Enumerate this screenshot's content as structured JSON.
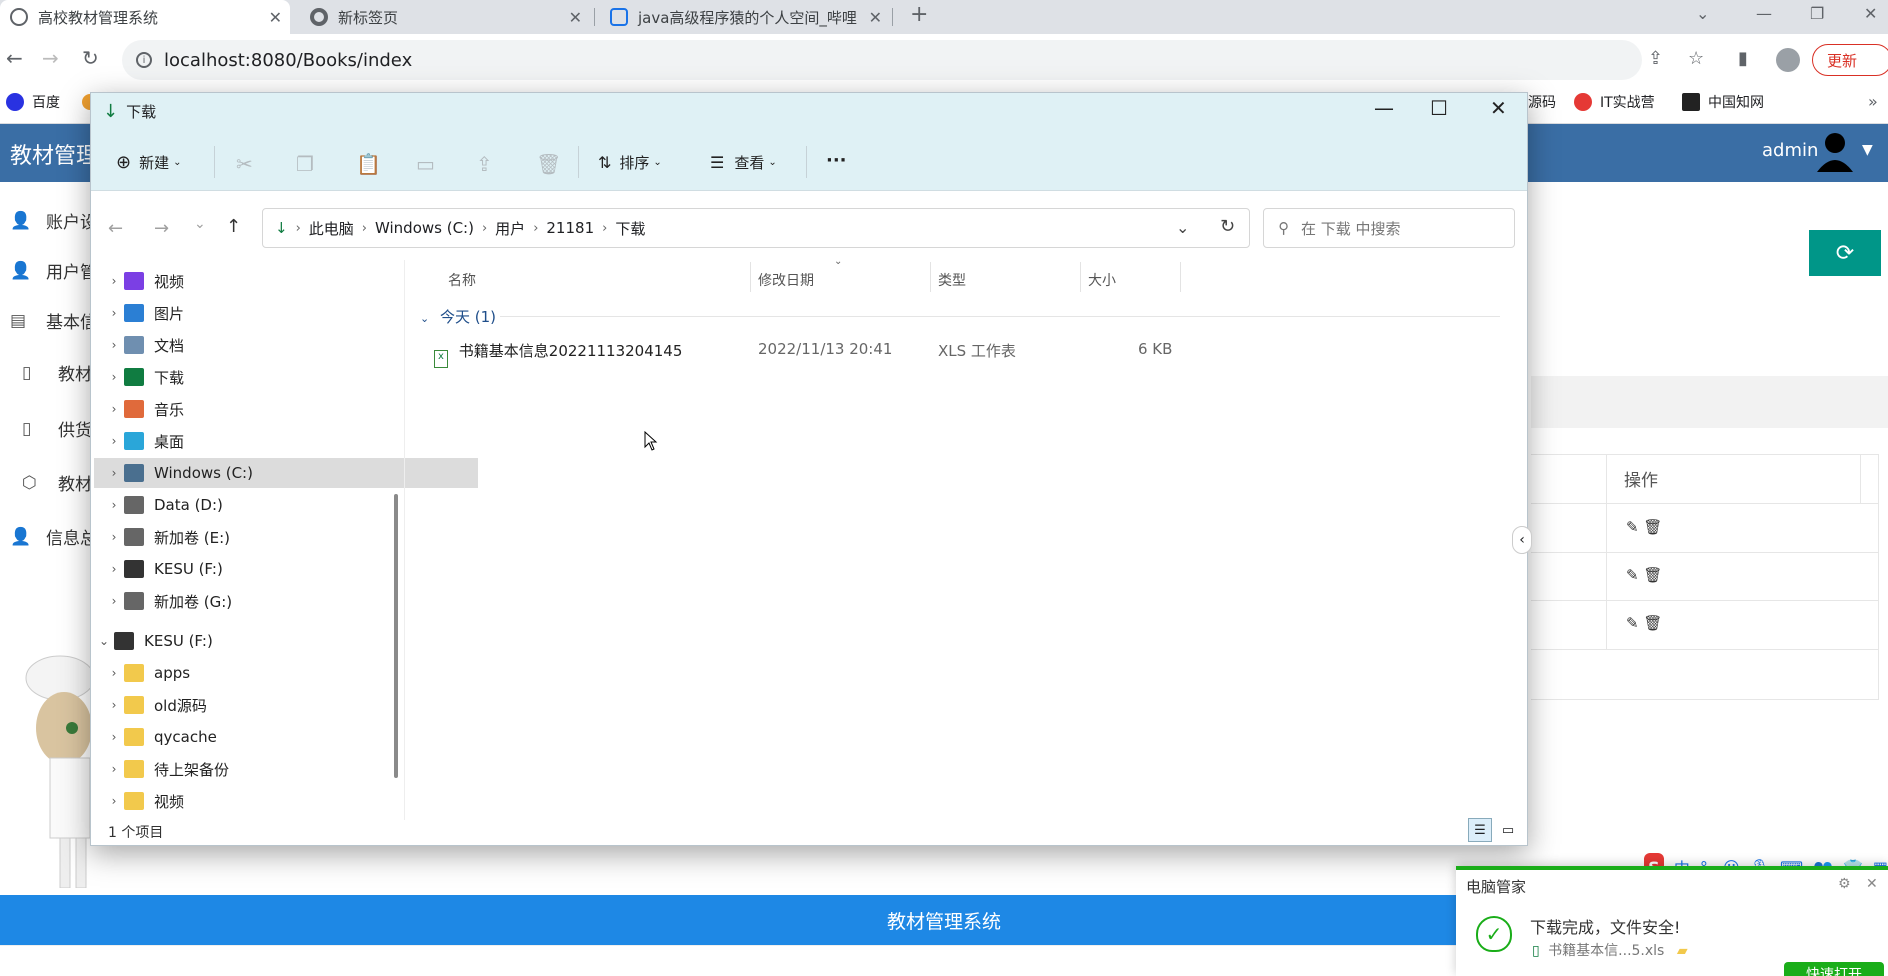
{
  "browser": {
    "tabs": [
      {
        "title": "高校教材管理系统",
        "active": true
      },
      {
        "title": "新标签页",
        "active": false
      },
      {
        "title": "java高级程序猿的个人空间_哔哩",
        "active": false
      }
    ],
    "url": "localhost:8080/Books/index",
    "update_label": "更新",
    "bookmarks": [
      "百度",
      "源码",
      "IT实战营",
      "中国知网"
    ]
  },
  "app": {
    "brand": "教材管理",
    "user": "admin",
    "sidebar": [
      "账户设",
      "用户管",
      "基本信",
      "教材",
      "供货",
      "教材",
      "信息总"
    ],
    "table_ops_header": "操作",
    "footer": "教材管理系统"
  },
  "explorer": {
    "title": "下载",
    "toolbar": {
      "new": "新建",
      "sort": "排序",
      "view": "查看",
      "more": "···"
    },
    "breadcrumb": [
      "此电脑",
      "Windows (C:)",
      "用户",
      "21181",
      "下载"
    ],
    "search_placeholder": "在 下载 中搜索",
    "tree": [
      {
        "label": "视频",
        "color": "#7b3fe4",
        "level": 1
      },
      {
        "label": "图片",
        "color": "#2b7fd4",
        "level": 1
      },
      {
        "label": "文档",
        "color": "#6f8fb0",
        "level": 1
      },
      {
        "label": "下载",
        "color": "#107c41",
        "level": 1
      },
      {
        "label": "音乐",
        "color": "#e06a3b",
        "level": 1
      },
      {
        "label": "桌面",
        "color": "#2aa6d9",
        "level": 1
      },
      {
        "label": "Windows (C:)",
        "color": "#4a6f8f",
        "level": 1,
        "selected": true
      },
      {
        "label": "Data (D:)",
        "color": "#666666",
        "level": 1
      },
      {
        "label": "新加卷 (E:)",
        "color": "#666666",
        "level": 1
      },
      {
        "label": "KESU  (F:)",
        "color": "#333333",
        "level": 1
      },
      {
        "label": "新加卷 (G:)",
        "color": "#666666",
        "level": 1
      },
      {
        "label": "KESU  (F:)",
        "color": "#333333",
        "level": 0,
        "expanded": true
      },
      {
        "label": "apps",
        "color": "#f2c94c",
        "level": 1
      },
      {
        "label": "old源码",
        "color": "#f2c94c",
        "level": 1
      },
      {
        "label": "qycache",
        "color": "#f2c94c",
        "level": 1
      },
      {
        "label": "待上架备份",
        "color": "#f2c94c",
        "level": 1
      },
      {
        "label": "视频",
        "color": "#f2c94c",
        "level": 1
      }
    ],
    "columns": [
      "名称",
      "修改日期",
      "类型",
      "大小"
    ],
    "group": "今天 (1)",
    "file": {
      "name": "书籍基本信息20221113204145",
      "date": "2022/11/13 20:41",
      "type": "XLS 工作表",
      "size": "6 KB"
    },
    "status": "1 个项目"
  },
  "notify": {
    "title": "电脑管家",
    "message": "下载完成，文件安全!",
    "file": "书籍基本信...5.xls",
    "open": "快速打开"
  },
  "ime": {
    "lang": "中"
  }
}
